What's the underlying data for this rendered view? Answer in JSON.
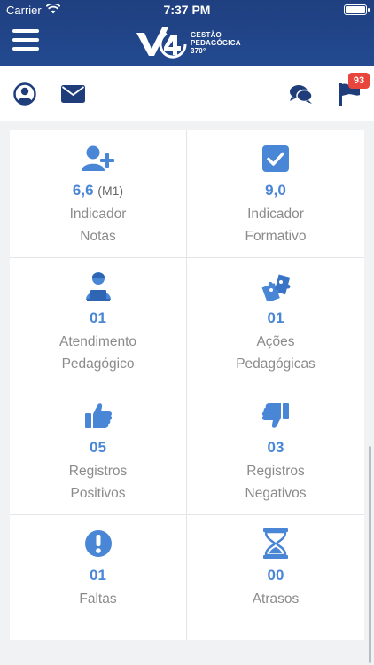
{
  "status_bar": {
    "carrier": "Carrier",
    "time": "7:37 PM"
  },
  "header": {
    "logo_line1": "GESTÃO",
    "logo_line2": "PEDAGÓGICA",
    "logo_line3": "370°"
  },
  "toolbar": {
    "notifications_count": "93"
  },
  "cards": [
    {
      "icon": "user-plus-icon",
      "value": "6,6",
      "suffix": "(M1)",
      "line1": "Indicador",
      "line2": "Notas"
    },
    {
      "icon": "checkbox-icon",
      "value": "9,0",
      "suffix": "",
      "line1": "Indicador",
      "line2": "Formativo"
    },
    {
      "icon": "user-laptop-icon",
      "value": "01",
      "suffix": "",
      "line1": "Atendimento",
      "line2": "Pedagógico"
    },
    {
      "icon": "puzzle-icon",
      "value": "01",
      "suffix": "",
      "line1": "Ações",
      "line2": "Pedagógicas"
    },
    {
      "icon": "thumbs-up-icon",
      "value": "05",
      "suffix": "",
      "line1": "Registros",
      "line2": "Positivos"
    },
    {
      "icon": "thumbs-down-icon",
      "value": "03",
      "suffix": "",
      "line1": "Registros",
      "line2": "Negativos"
    },
    {
      "icon": "exclamation-circle-icon",
      "value": "01",
      "suffix": "",
      "line1": "Faltas",
      "line2": ""
    },
    {
      "icon": "hourglass-icon",
      "value": "00",
      "suffix": "",
      "line1": "Atrasos",
      "line2": ""
    }
  ],
  "colors": {
    "header": "#1f3f80",
    "accent": "#4a86d6",
    "badge": "#e8453c"
  }
}
